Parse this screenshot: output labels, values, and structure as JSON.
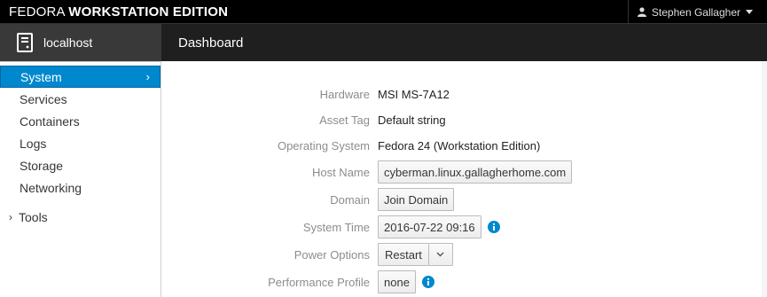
{
  "brand": {
    "thin": "FEDORA",
    "bold": "WORKSTATION EDITION"
  },
  "user": {
    "name": "Stephen Gallagher"
  },
  "host": {
    "name": "localhost"
  },
  "page": {
    "title": "Dashboard"
  },
  "sidebar": {
    "items": [
      {
        "label": "System",
        "active": true
      },
      {
        "label": "Services"
      },
      {
        "label": "Containers"
      },
      {
        "label": "Logs"
      },
      {
        "label": "Storage"
      },
      {
        "label": "Networking"
      }
    ],
    "tools_label": "Tools"
  },
  "system": {
    "hardware": {
      "label": "Hardware",
      "value": "MSI MS-7A12"
    },
    "asset_tag": {
      "label": "Asset Tag",
      "value": "Default string"
    },
    "os": {
      "label": "Operating System",
      "value": "Fedora 24 (Workstation Edition)"
    },
    "host_name": {
      "label": "Host Name",
      "value": "cyberman.linux.gallagherhome.com"
    },
    "domain": {
      "label": "Domain",
      "value": "Join Domain"
    },
    "system_time": {
      "label": "System Time",
      "value": "2016-07-22 09:16"
    },
    "power": {
      "label": "Power Options",
      "value": "Restart"
    },
    "performance": {
      "label": "Performance Profile",
      "value": "none"
    }
  },
  "colors": {
    "accent": "#0088ce",
    "topbar": "#000000",
    "hostbar": "#1f1f1f",
    "info": "#0088ce"
  },
  "icons": [
    "user-icon",
    "caret-down-icon",
    "server-icon",
    "chevron-right-icon",
    "info-icon",
    "chevron-down-icon"
  ]
}
